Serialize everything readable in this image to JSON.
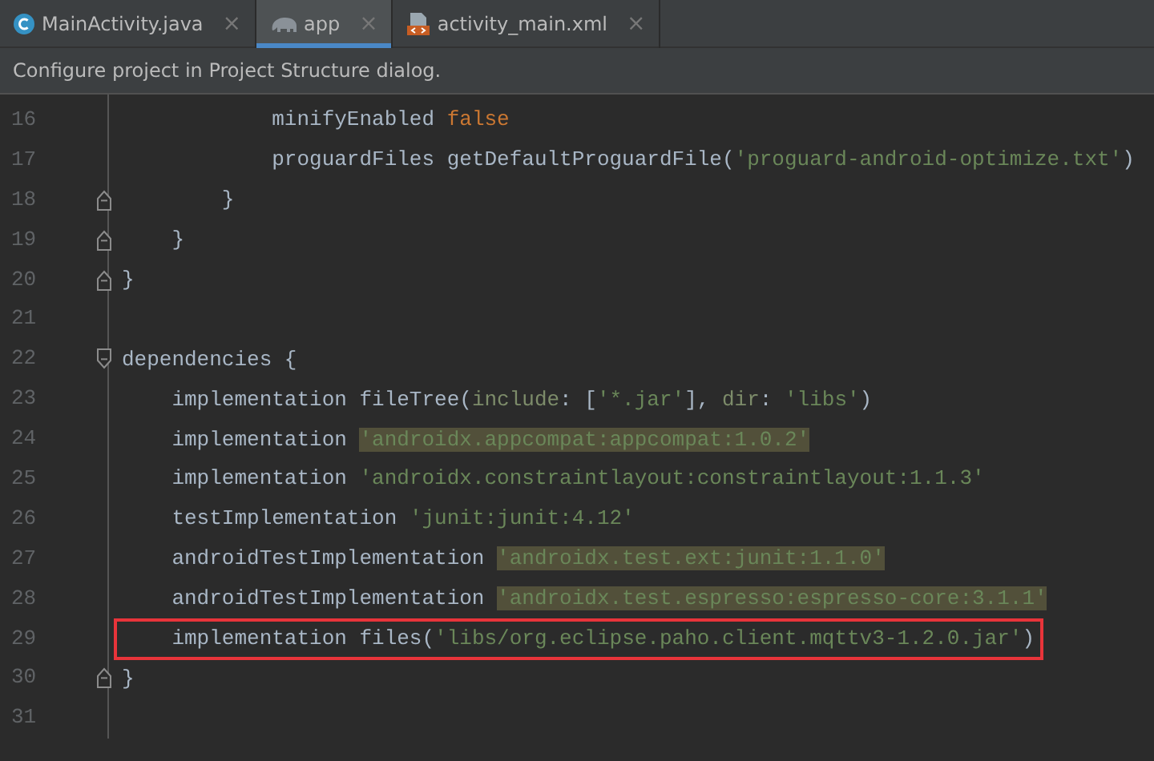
{
  "tabs": [
    {
      "label": "MainActivity.java",
      "selected": false,
      "close": "×"
    },
    {
      "label": "app",
      "selected": true,
      "close": "×"
    },
    {
      "label": "activity_main.xml",
      "selected": false,
      "close": "×"
    }
  ],
  "banner": "Configure project in Project Structure dialog.",
  "lines": [
    {
      "number": "16",
      "tokens": [
        {
          "kind": "plain",
          "text": "            minifyEnabled "
        },
        {
          "kind": "keyword",
          "text": "false"
        }
      ]
    },
    {
      "number": "17",
      "tokens": [
        {
          "kind": "plain",
          "text": "            proguardFiles getDefaultProguardFile("
        },
        {
          "kind": "string",
          "text": "'proguard-android-optimize.txt'"
        },
        {
          "kind": "plain",
          "text": ")"
        }
      ]
    },
    {
      "number": "18",
      "fold": {
        "kind": "end"
      },
      "tokens": [
        {
          "kind": "plain",
          "text": "        }"
        }
      ]
    },
    {
      "number": "19",
      "fold": {
        "kind": "end"
      },
      "tokens": [
        {
          "kind": "plain",
          "text": "    }"
        }
      ]
    },
    {
      "number": "20",
      "fold": {
        "kind": "end"
      },
      "tokens": [
        {
          "kind": "plain",
          "text": "}"
        }
      ]
    },
    {
      "number": "21"
    },
    {
      "number": "22",
      "fold": {
        "kind": "start"
      },
      "tokens": [
        {
          "kind": "plain",
          "text": "dependencies {"
        }
      ]
    },
    {
      "number": "23",
      "tokens": [
        {
          "kind": "plain",
          "text": "    implementation fileTree("
        },
        {
          "kind": "param",
          "text": "include"
        },
        {
          "kind": "plain",
          "text": ": ["
        },
        {
          "kind": "string",
          "text": "'*.jar'"
        },
        {
          "kind": "plain",
          "text": "], "
        },
        {
          "kind": "param",
          "text": "dir"
        },
        {
          "kind": "plain",
          "text": ": "
        },
        {
          "kind": "string",
          "text": "'libs'"
        },
        {
          "kind": "plain",
          "text": ")"
        }
      ]
    },
    {
      "number": "24",
      "tokens": [
        {
          "kind": "plain",
          "text": "    implementation "
        },
        {
          "kind": "highlight",
          "text": "'androidx.appcompat:appcompat:1.0.2'"
        }
      ]
    },
    {
      "number": "25",
      "tokens": [
        {
          "kind": "plain",
          "text": "    implementation "
        },
        {
          "kind": "string",
          "text": "'androidx.constraintlayout:constraintlayout:1.1.3'"
        }
      ]
    },
    {
      "number": "26",
      "tokens": [
        {
          "kind": "plain",
          "text": "    testImplementation "
        },
        {
          "kind": "string",
          "text": "'junit:junit:4.12'"
        }
      ]
    },
    {
      "number": "27",
      "tokens": [
        {
          "kind": "plain",
          "text": "    androidTestImplementation "
        },
        {
          "kind": "highlight",
          "text": "'androidx.test.ext:junit:1.1.0'"
        }
      ]
    },
    {
      "number": "28",
      "tokens": [
        {
          "kind": "plain",
          "text": "    androidTestImplementation "
        },
        {
          "kind": "highlight",
          "text": "'androidx.test.espresso:espresso-core:3.1.1'"
        }
      ]
    },
    {
      "number": "29",
      "boxed": true,
      "tokens": [
        {
          "kind": "plain",
          "text": "    implementation files("
        },
        {
          "kind": "string",
          "text": "'libs/org.eclipse.paho.client.mqttv3-1.2.0.jar'"
        },
        {
          "kind": "plain",
          "text": ")"
        }
      ]
    },
    {
      "number": "30",
      "fold": {
        "kind": "end"
      },
      "tokens": [
        {
          "kind": "plain",
          "text": "}"
        }
      ]
    },
    {
      "number": "31"
    }
  ]
}
